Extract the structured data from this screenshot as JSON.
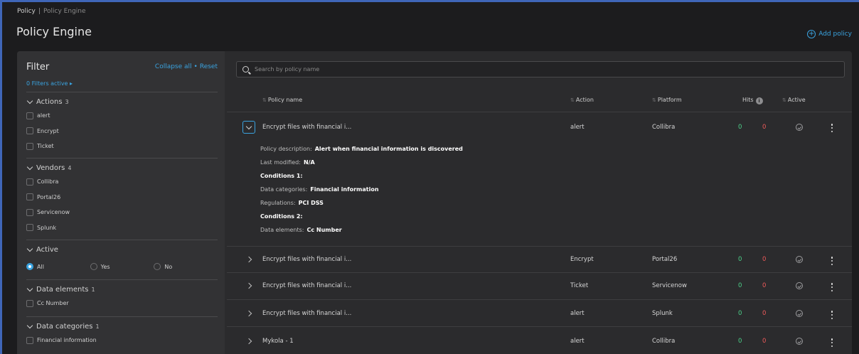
{
  "breadcrumb": {
    "root": "Policy",
    "separator": "|",
    "current": "Policy Engine"
  },
  "page_title": "Policy Engine",
  "add_policy_label": "Add policy",
  "filter": {
    "title": "Filter",
    "collapse_all": "Collapse all",
    "link_separator": "•",
    "reset": "Reset",
    "filters_active": "0 Filters active ▸",
    "sections": [
      {
        "label": "Actions",
        "count": "3",
        "items": [
          "alert",
          "Encrypt",
          "Ticket"
        ]
      },
      {
        "label": "Vendors",
        "count": "4",
        "items": [
          "Collibra",
          "Portal26",
          "Servicenow",
          "Splunk"
        ]
      },
      {
        "label": "Active",
        "count": "",
        "radio": [
          {
            "label": "All",
            "selected": true
          },
          {
            "label": "Yes",
            "selected": false
          },
          {
            "label": "No",
            "selected": false
          }
        ]
      },
      {
        "label": "Data elements",
        "count": "1",
        "items": [
          "Cc Number"
        ]
      },
      {
        "label": "Data categories",
        "count": "1",
        "items": [
          "Financial information"
        ]
      }
    ]
  },
  "search": {
    "placeholder": "Search by policy name"
  },
  "table": {
    "columns": {
      "name": "Policy name",
      "action": "Action",
      "platform": "Platform",
      "hits": "Hits",
      "active": "Active"
    },
    "sort_icon": "⇅",
    "info_icon": "i",
    "rows": [
      {
        "name": "Encrypt files with financial i...",
        "action": "alert",
        "platform": "Collibra",
        "hits_green": "0",
        "hits_red": "0",
        "expanded": true
      },
      {
        "name": "Encrypt files with financial i...",
        "action": "Encrypt",
        "platform": "Portal26",
        "hits_green": "0",
        "hits_red": "0",
        "expanded": false
      },
      {
        "name": "Encrypt files with financial i...",
        "action": "Ticket",
        "platform": "Servicenow",
        "hits_green": "0",
        "hits_red": "0",
        "expanded": false
      },
      {
        "name": "Encrypt files with financial i...",
        "action": "alert",
        "platform": "Splunk",
        "hits_green": "0",
        "hits_red": "0",
        "expanded": false
      },
      {
        "name": "Mykola - 1",
        "action": "alert",
        "platform": "Collibra",
        "hits_green": "0",
        "hits_red": "0",
        "expanded": false
      }
    ],
    "details": {
      "description_label": "Policy description:",
      "description_value": "Alert when financial information is discovered",
      "modified_label": "Last modified:",
      "modified_value": "N/A",
      "conditions1": "Conditions 1:",
      "categories_label": "Data categories:",
      "categories_value": "Financial information",
      "regulations_label": "Regulations:",
      "regulations_value": "PCI DSS",
      "conditions2": "Conditions 2:",
      "elements_label": "Data elements:",
      "elements_value": "Cc Number"
    }
  },
  "colors": {
    "accent": "#3aa3e0",
    "frame": "#3f66b8",
    "hit_green": "#4cd38a",
    "hit_red": "#ef5a5a"
  },
  "icons": [
    "plus-circle-icon",
    "chevron-down-icon",
    "chevron-right-icon",
    "search-icon",
    "sort-icon",
    "info-icon",
    "check-circle-icon",
    "kebab-menu-icon"
  ]
}
